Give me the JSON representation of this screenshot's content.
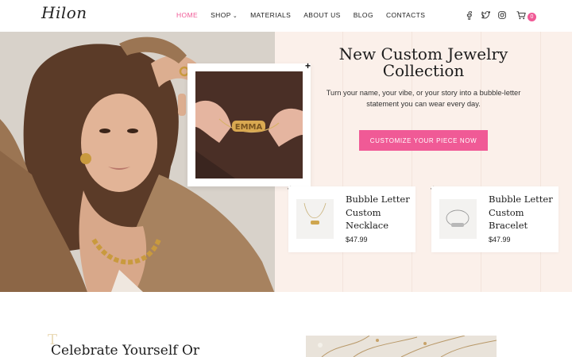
{
  "brand": {
    "logo_text": "Hilon"
  },
  "nav": {
    "items": [
      {
        "label": "HOME",
        "active": true
      },
      {
        "label": "SHOP",
        "caret": "⌄"
      },
      {
        "label": "MATERIALS"
      },
      {
        "label": "ABOUT US"
      },
      {
        "label": "BLOG"
      },
      {
        "label": "CONTACTS"
      }
    ]
  },
  "header_icons": {
    "social": [
      "facebook-icon",
      "twitter-icon",
      "instagram-icon"
    ],
    "cart_icon": "cart-icon",
    "cart_count": "0"
  },
  "hero": {
    "title": "New Custom Jewelry Collection",
    "subtitle": "Turn your name, your vibe, or your story into a bubble-letter statement you can wear every day.",
    "cta_label": "CUSTOMIZE YOUR PIECE NOW",
    "inset_text": "EMMA"
  },
  "products": [
    {
      "name": "Bubble Letter Custom Necklace",
      "price": "$47.99"
    },
    {
      "name": "Bubble Letter Custom Bracelet",
      "price": "$47.99"
    }
  ],
  "plus_symbol": "+",
  "lower": {
    "heading": "Celebrate Yourself Or",
    "deco_letter": "T"
  },
  "colors": {
    "accent": "#f05a96",
    "hero_bg": "#fbf0ea",
    "text": "#1c1c1c"
  }
}
